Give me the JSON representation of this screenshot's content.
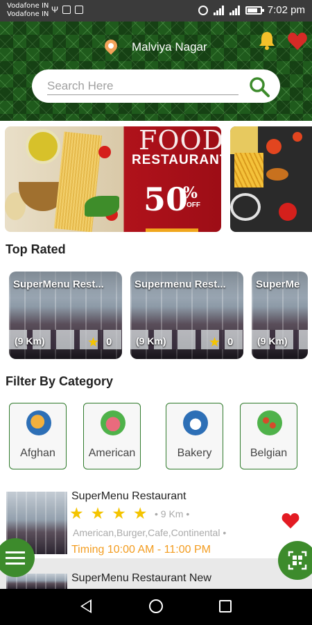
{
  "status_bar": {
    "carrier1": "Vodafone IN",
    "carrier2": "Vodafone IN",
    "time": "7:02 pm"
  },
  "header": {
    "location": "Malviya Nagar",
    "search_placeholder": "Search Here",
    "icons": [
      "location-pin-icon",
      "bell-icon",
      "heart-icon",
      "search-icon"
    ],
    "brand_color": "#1f5a1c"
  },
  "banners": [
    {
      "title": "FOOD",
      "subtitle": "RESTAURANT",
      "discount": "50",
      "percent": "%",
      "off": "OFF"
    },
    {
      "image": "food-platter"
    }
  ],
  "top_rated": {
    "title": "Top Rated",
    "cards": [
      {
        "name": "SuperMenu Rest...",
        "distance": "(9 Km)",
        "rating": "0"
      },
      {
        "name": "Supermenu Rest...",
        "distance": "(9 Km)",
        "rating": "0"
      },
      {
        "name": "SuperMe",
        "distance": "(9 Km)",
        "rating": ""
      }
    ]
  },
  "categories": {
    "title": "Filter By Category",
    "items": [
      {
        "label": "Afghan",
        "color": "#e3a23a"
      },
      {
        "label": "American",
        "color": "#e96b7d"
      },
      {
        "label": "Bakery",
        "color": "#2d6fb6"
      },
      {
        "label": "Belgian",
        "color": "#d64b2b"
      }
    ]
  },
  "list": {
    "items": [
      {
        "name": "SuperMenu Restaurant",
        "stars": 4,
        "distance": "• 9 Km •",
        "cuisine": "American,Burger,Cafe,Continental  •",
        "timing": "Timing 10:00 AM - 11:00 PM"
      },
      {
        "name": "SuperMenu Restaurant New"
      }
    ]
  },
  "colors": {
    "accent_green": "#3d8b2c",
    "timing_orange": "#f39c1f",
    "heart_red": "#e31b23",
    "star_yellow": "#f4c400"
  }
}
